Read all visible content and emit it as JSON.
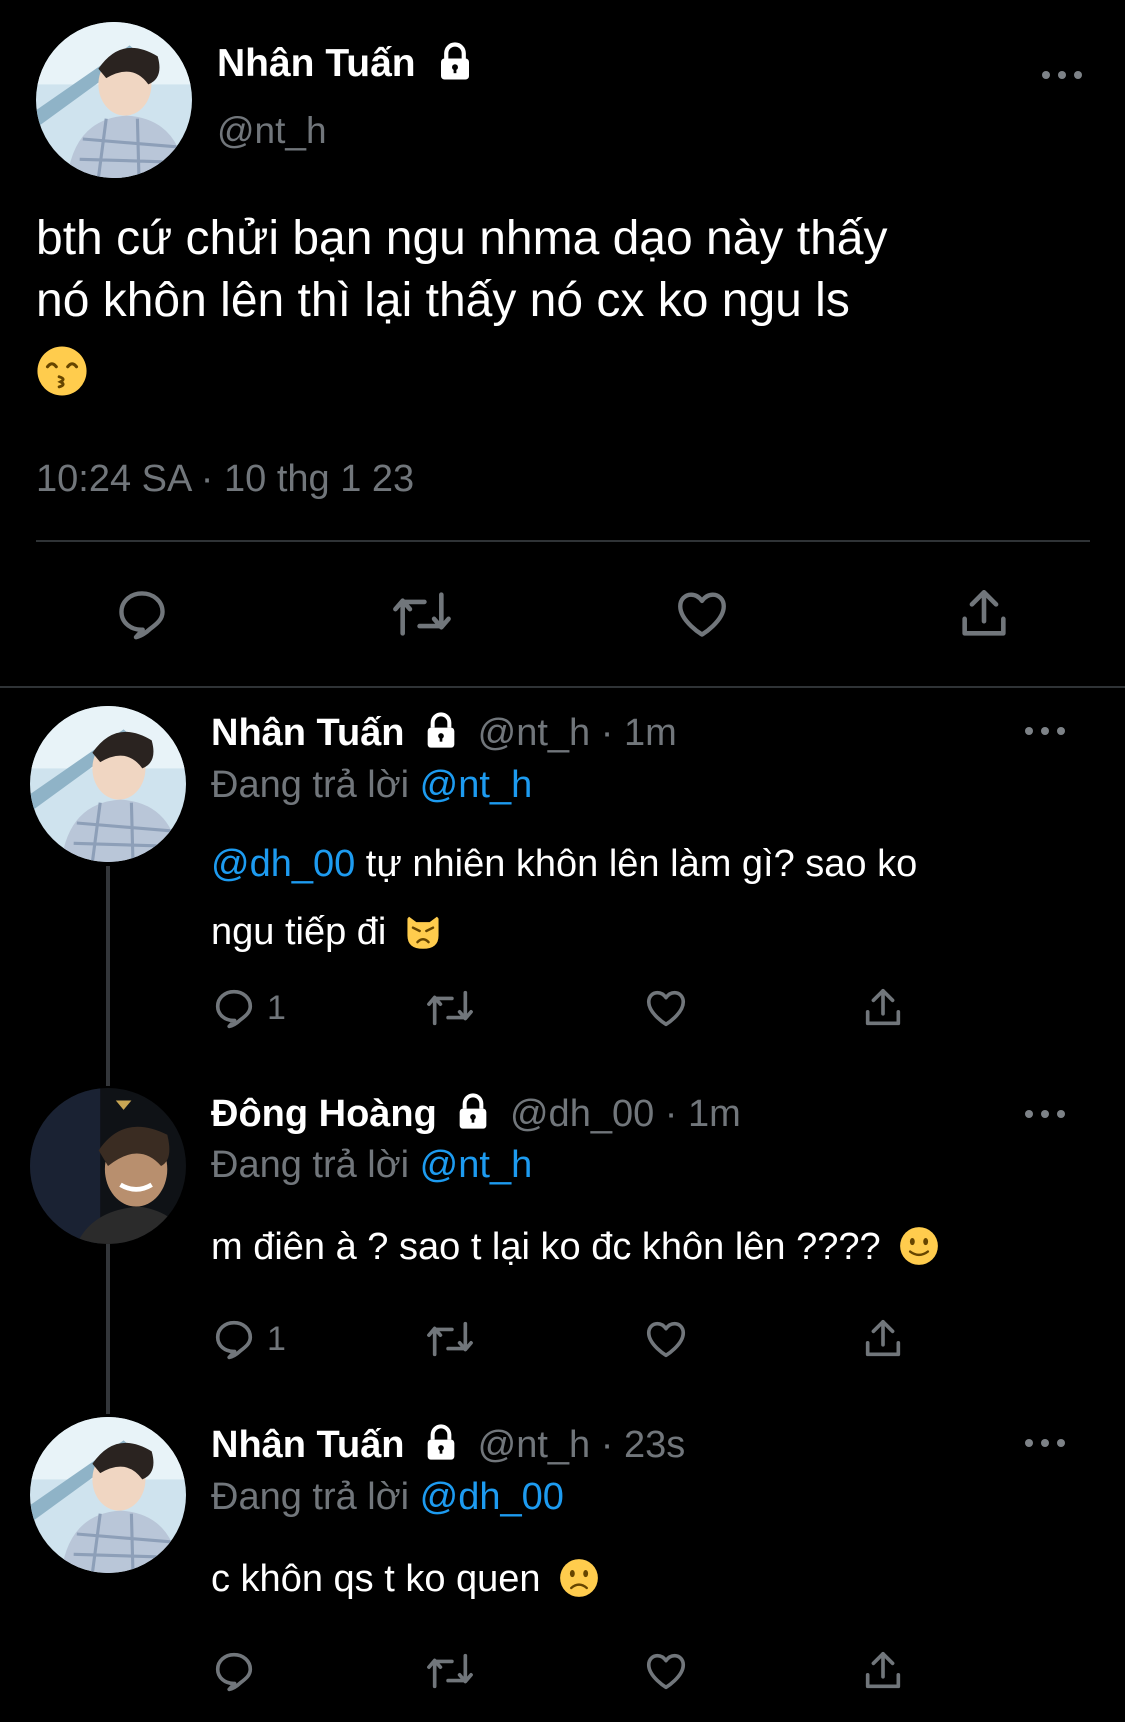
{
  "main_tweet": {
    "name": "Nhân Tuấn",
    "handle": "@nt_h",
    "text_line1": "bth cứ chửi bạn ngu nhma dạo này thấy",
    "text_line2": "nó khôn lên thì lại thấy nó cx ko ngu ls",
    "emoji": "kissing-smiling-eyes",
    "timestamp": "10:24 SA · 10 thg 1 23"
  },
  "replies": [
    {
      "name": "Nhân Tuấn",
      "handle": "@nt_h",
      "time": "· 1m",
      "replying_prefix": "Đang trả lời",
      "replying_to": "@nt_h",
      "mention": "@dh_00",
      "text_line1": " tự nhiên khôn lên làm gì? sao ko",
      "text_line2": "ngu tiếp đi",
      "emoji": "pouting-cat",
      "reply_count": "1"
    },
    {
      "name": "Đông Hoàng",
      "handle": "@dh_00",
      "time": "· 1m",
      "replying_prefix": "Đang trả lời",
      "replying_to": "@nt_h",
      "text_line1": "m điên à ? sao t lại ko đc khôn lên ????",
      "emoji": "slightly-smiling-face",
      "reply_count": "1"
    },
    {
      "name": "Nhân Tuấn",
      "handle": "@nt_h",
      "time": "· 23s",
      "replying_prefix": "Đang trả lời",
      "replying_to": "@dh_00",
      "text_line1": "c khôn qs t ko quen",
      "emoji": "slightly-frowning-face",
      "reply_count": ""
    }
  ],
  "colors": {
    "background": "#000000",
    "text": "#e7e9ea",
    "muted": "#71767b",
    "link": "#1d9bf0",
    "divider": "#2f3336"
  }
}
